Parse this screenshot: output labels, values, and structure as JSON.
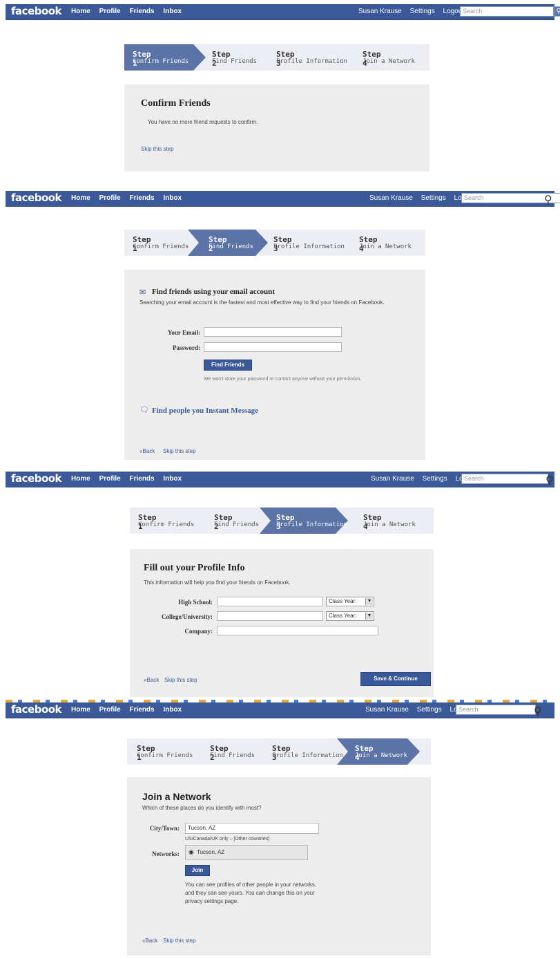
{
  "topbar": {
    "logo": "facebook",
    "nav": [
      "Home",
      "Profile",
      "Friends",
      "Inbox"
    ],
    "user": "Susan Krause",
    "settings": "Settings",
    "logout": "Logout",
    "search_placeholder": "Search"
  },
  "steps": [
    {
      "num": "Step 1",
      "label": "Confirm Friends"
    },
    {
      "num": "Step 2",
      "label": "Find Friends"
    },
    {
      "num": "Step 3",
      "label": "Profile Information"
    },
    {
      "num": "Step 4",
      "label": "Join a Network"
    }
  ],
  "screens": {
    "confirm": {
      "title": "Confirm Friends",
      "message": "You have no more friend requests to confirm.",
      "skip": "Skip this step"
    },
    "find": {
      "title": "Find friends using your email account",
      "desc": "Searching your email account is the fastest and most effective way to find your friends on Facebook.",
      "email_label": "Your Email:",
      "password_label": "Password:",
      "button": "Find Friends",
      "note": "We won't store your password or contact anyone without your permission.",
      "im_title": "Find people you Instant Message",
      "back": "«Back",
      "skip": "Skip this step"
    },
    "profile": {
      "title": "Fill out your Profile Info",
      "desc": "This information will help you find your friends on Facebook.",
      "high_school_label": "High School:",
      "college_label": "College/University:",
      "company_label": "Company:",
      "class_year": "Class Year:",
      "back": "«Back",
      "skip": "Skip this step",
      "button": "Save & Continue"
    },
    "network": {
      "title": "Join a Network",
      "desc": "Which of these places do you identify with most?",
      "city_label": "City/Town:",
      "city_value": "Tucson, AZ",
      "city_hint": "US/Canada/UK only – [Other countries]",
      "networks_label": "Networks:",
      "network_option": "Tucson, AZ",
      "button": "Join",
      "note1": "You can see profiles of other people in your networks,",
      "note2": "and they can see yours. You can change this on your",
      "note3": "privacy settings page.",
      "back": "«Back",
      "skip": "Skip this step"
    }
  },
  "colors": {
    "brand": "#3b5998",
    "step_active": "#5b73a6",
    "panel": "#ededed"
  }
}
